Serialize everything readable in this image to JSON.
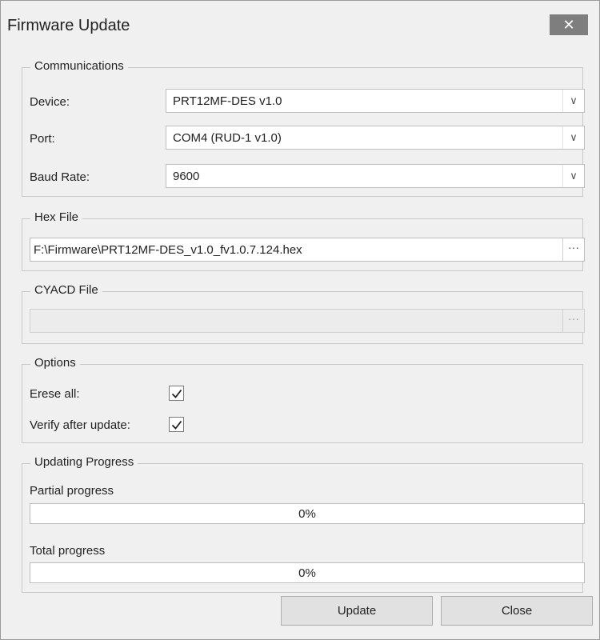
{
  "window": {
    "title": "Firmware Update",
    "close_label": "✕"
  },
  "communications": {
    "legend": "Communications",
    "device_label": "Device:",
    "device_value": "PRT12MF-DES v1.0",
    "port_label": "Port:",
    "port_value": "COM4 (RUD-1 v1.0)",
    "baud_label": "Baud Rate:",
    "baud_value": "9600"
  },
  "hex_file": {
    "legend": "Hex File",
    "path": "F:\\Firmware\\PRT12MF-DES_v1.0_fv1.0.7.124.hex",
    "browse_label": "···"
  },
  "cyacd_file": {
    "legend": "CYACD File",
    "path": "",
    "browse_label": "···"
  },
  "options": {
    "legend": "Options",
    "erase_label": "Erese all:",
    "erase_checked": true,
    "verify_label": "Verify after update:",
    "verify_checked": true
  },
  "progress": {
    "legend": "Updating Progress",
    "partial_label": "Partial progress",
    "partial_value": 0,
    "partial_text": "0%",
    "total_label": "Total progress",
    "total_value": 0,
    "total_text": "0%"
  },
  "buttons": {
    "update_label": "Update",
    "close_label": "Close"
  },
  "colors": {
    "progress_fill": "#06b025",
    "titlebar_close_bg": "#7e7e7e"
  }
}
